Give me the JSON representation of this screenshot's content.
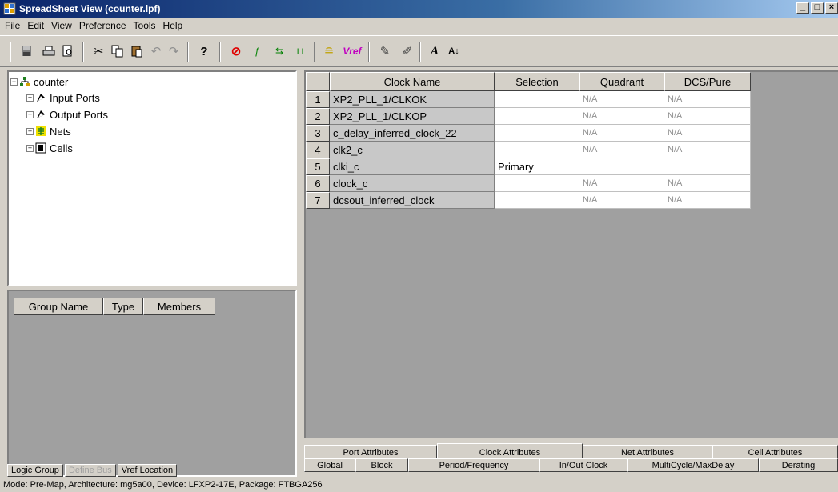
{
  "window": {
    "title": "SpreadSheet View (counter.lpf)",
    "buttons": [
      "_",
      "□",
      "×"
    ]
  },
  "menu": [
    "File",
    "Edit",
    "View",
    "Preference",
    "Tools",
    "Help"
  ],
  "toolbar": {
    "vref_label": "Vref",
    "font_label": "A",
    "sort_label": "A↓"
  },
  "tree": {
    "root": "counter",
    "children": [
      "Input Ports",
      "Output Ports",
      "Nets",
      "Cells"
    ]
  },
  "group_panel": {
    "headers": [
      "Group Name",
      "Type",
      "Members"
    ]
  },
  "left_tabs": [
    "Logic Group",
    "Define Bus",
    "Vref Location"
  ],
  "sheet": {
    "columns": [
      "Clock Name",
      "Selection",
      "Quadrant",
      "DCS/Pure"
    ],
    "rows": [
      {
        "num": "1",
        "name": "XP2_PLL_1/CLKOK",
        "selection": "",
        "quadrant": "N/A",
        "dcs": "N/A"
      },
      {
        "num": "2",
        "name": "XP2_PLL_1/CLKOP",
        "selection": "",
        "quadrant": "N/A",
        "dcs": "N/A"
      },
      {
        "num": "3",
        "name": "c_delay_inferred_clock_22",
        "selection": "",
        "quadrant": "N/A",
        "dcs": "N/A"
      },
      {
        "num": "4",
        "name": "clk2_c",
        "selection": "",
        "quadrant": "N/A",
        "dcs": "N/A"
      },
      {
        "num": "5",
        "name": "clki_c",
        "selection": "Primary",
        "quadrant": "",
        "dcs": ""
      },
      {
        "num": "6",
        "name": "clock_c",
        "selection": "",
        "quadrant": "N/A",
        "dcs": "N/A"
      },
      {
        "num": "7",
        "name": "dcsout_inferred_clock",
        "selection": "",
        "quadrant": "N/A",
        "dcs": "N/A"
      }
    ]
  },
  "attr_tabs": [
    "Port Attributes",
    "Clock Attributes",
    "Net Attributes",
    "Cell Attributes"
  ],
  "sub_tabs": [
    "Global",
    "Block",
    "Period/Frequency",
    "In/Out Clock",
    "MultiCycle/MaxDelay",
    "Derating"
  ],
  "status": "Mode: Pre-Map,    Architecture: mg5a00,  Device: LFXP2-17E,  Package: FTBGA256"
}
